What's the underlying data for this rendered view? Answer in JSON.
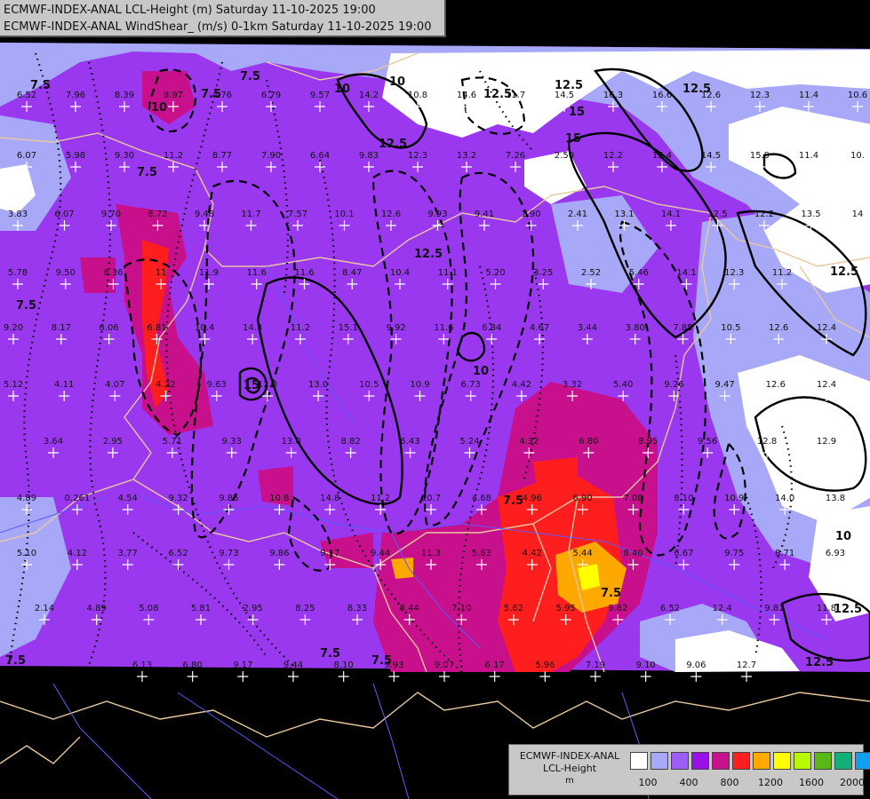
{
  "title_lines": [
    "ECMWF-INDEX-ANAL LCL-Height (m) Saturday 11-10-2025 19:00",
    "ECMWF-INDEX-ANAL WindShear_ (m/s) 0-1km Saturday 11-10-2025 19:00"
  ],
  "legend": {
    "title": "ECMWF-INDEX-ANAL",
    "subtitle": "LCL-Height",
    "unit": "m",
    "colors": [
      "#ffffff",
      "#a8a8f8",
      "#9f5cf6",
      "#9a10e8",
      "#c8108c",
      "#ff1e1e",
      "#ffa800",
      "#ffff00",
      "#b8f800",
      "#58b818",
      "#10b078",
      "#10a0f0"
    ],
    "ticks": [
      "100",
      "400",
      "800",
      "1200",
      "1600",
      "2000"
    ]
  },
  "colors": {
    "background": "#000000",
    "land_base": "#9a38f0",
    "light_violet": "#a8a8f8",
    "white_zone": "#ffffff",
    "magenta": "#c8108c",
    "red": "#ff1e1e",
    "orange": "#ffa800",
    "yellow": "#ffff00",
    "border": "#e8c8a0",
    "river": "#5a5aff"
  },
  "contour_labels": [
    "7.5",
    "10",
    "12.5",
    "15",
    "7.5",
    "10",
    "12.5",
    "7.5",
    "12.5",
    "7.5",
    "10",
    "15",
    "12.5",
    "10",
    "7.5",
    "7.5",
    "7.5",
    "12.5",
    "12.5",
    "7.5",
    "15",
    "7.5",
    "12.5",
    "7.5",
    "12.5",
    "10"
  ],
  "station_values": [
    "6.52",
    "7.96",
    "8.39",
    "8.97",
    "4.76",
    "6.79",
    "9.57",
    "14.2",
    "10.8",
    "14.6",
    "11.7",
    "14.5",
    "16.3",
    "16.6",
    "12.6",
    "12.3",
    "11.4",
    "10.6",
    "6.07",
    "5.98",
    "9.30",
    "11.2",
    "8.77",
    "7.90",
    "6.64",
    "9.83",
    "12.3",
    "13.2",
    "7.26",
    "2.50",
    "12.2",
    "15.4",
    "14.5",
    "15.9",
    "11.4",
    "10.",
    "3.83",
    "6.07",
    "9.70",
    "8.72",
    "9.48",
    "11.7",
    "7.57",
    "10.1",
    "12.6",
    "9.93",
    "9.41",
    "1.90",
    "2.41",
    "13.1",
    "14.1",
    "12.5",
    "12.2",
    "13.5",
    "14",
    "5.78",
    "9.50",
    "8.36",
    "11",
    "11.9",
    "11.6",
    "11.6",
    "8.47",
    "10.4",
    "11.1",
    "5.20",
    "3.25",
    "2.52",
    "5.46",
    "14.1",
    "12.3",
    "11.2",
    "9.20",
    "8.17",
    "6.06",
    "6.81",
    "10.4",
    "14.3",
    "11.2",
    "15.1",
    "9.92",
    "11.6",
    "6.84",
    "4.67",
    "3.44",
    "3.80",
    "7.85",
    "10.5",
    "12.6",
    "12.4",
    "5.12",
    "4.11",
    "4.07",
    "4.22",
    "9.63",
    "12.3",
    "13.0",
    "10.5",
    "10.9",
    "6.73",
    "4.42",
    "3.32",
    "5.40",
    "9.26",
    "9.47",
    "12.6",
    "12.4",
    "3.64",
    "2.95",
    "5.71",
    "9.33",
    "13.0",
    "8.82",
    "6.43",
    "5.24",
    "4.32",
    "6.80",
    "8.95",
    "9.56",
    "12.8",
    "12.9",
    "4.89",
    "0.261",
    "4.54",
    "9.32",
    "9.85",
    "10.8",
    "14.8",
    "11.2",
    "10.7",
    "4.68",
    "4.96",
    "6.90",
    "7.08",
    "8.10",
    "10.9",
    "14.0",
    "13.8",
    "5.10",
    "4.12",
    "3.77",
    "6.52",
    "9.73",
    "9.86",
    "9.17",
    "9.44",
    "11.3",
    "5.63",
    "4.42",
    "5.44",
    "8.40",
    "6.67",
    "9.75",
    "8.71",
    "6.93",
    "2.14",
    "4.89",
    "5.08",
    "5.81",
    "2.95",
    "8.25",
    "8.33",
    "8.44",
    "7.10",
    "5.62",
    "5.95",
    "9.82",
    "6.52",
    "12.4",
    "9.81",
    "11.8",
    "6.13",
    "6.80",
    "9.17",
    "9.44",
    "8.10",
    "9.93",
    "9.07",
    "6.17",
    "5.96",
    "7.19",
    "9.10",
    "9.06",
    "12.7"
  ]
}
